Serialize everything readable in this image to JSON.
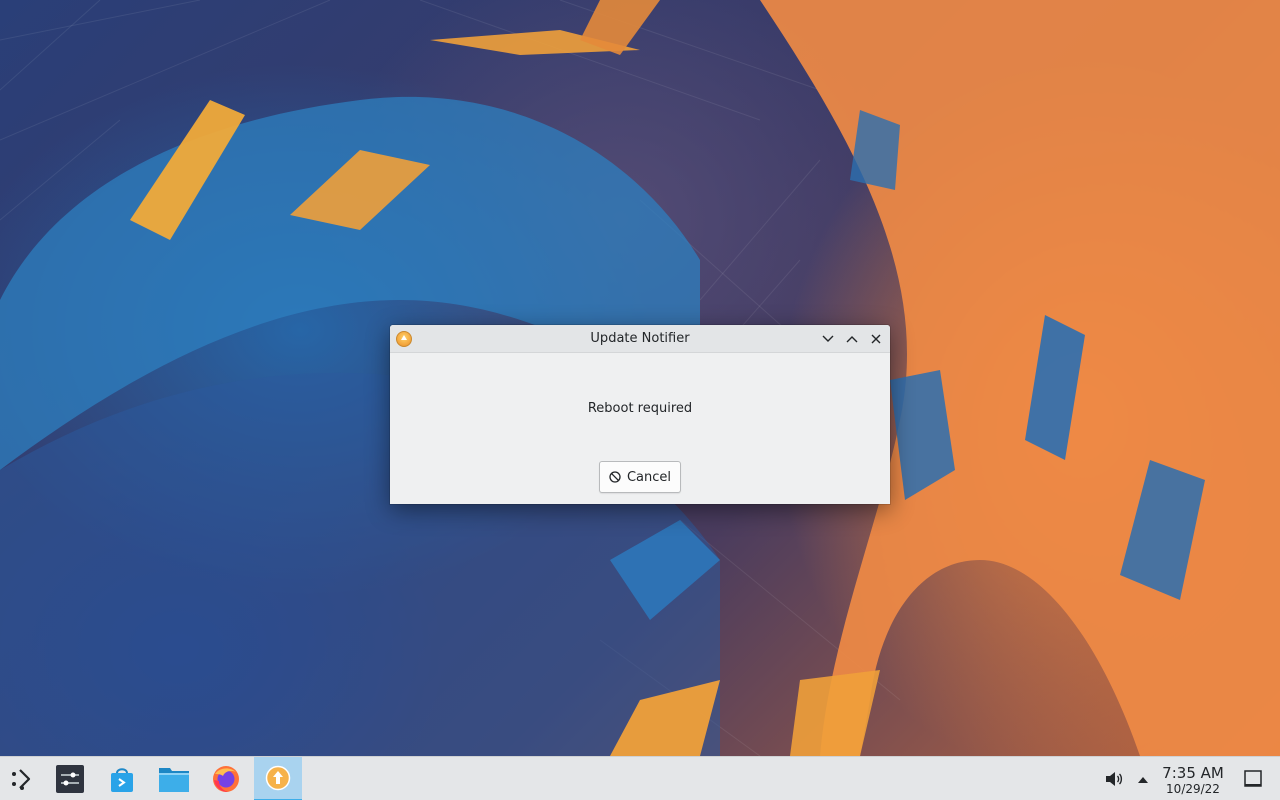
{
  "dialog": {
    "title": "Update Notifier",
    "message": "Reboot required",
    "cancel_label": "Cancel",
    "app_icon": "update-arrow-icon"
  },
  "taskbar": {
    "items": [
      {
        "name": "application-launcher",
        "icon": "kde-launcher-icon"
      },
      {
        "name": "system-settings",
        "icon": "settings-sliders-icon"
      },
      {
        "name": "discover",
        "icon": "discover-bag-icon"
      },
      {
        "name": "dolphin-files",
        "icon": "folder-icon"
      },
      {
        "name": "firefox",
        "icon": "firefox-icon"
      },
      {
        "name": "update-notifier",
        "icon": "update-arrow-icon",
        "active": true
      }
    ],
    "clock": {
      "time": "7:35 AM",
      "date": "10/29/22"
    }
  },
  "colors": {
    "accent": "#3daee9",
    "active_task_bg": "#a9d3ef",
    "window_bg": "#eff0f1",
    "panel_bg": "#e4e6e8"
  }
}
